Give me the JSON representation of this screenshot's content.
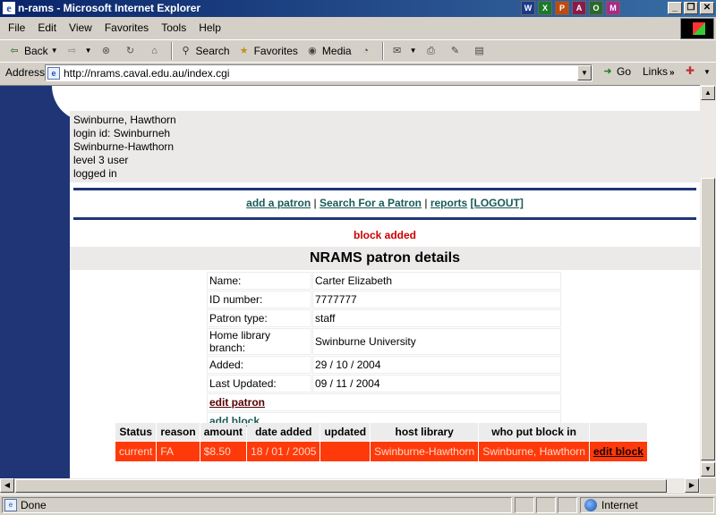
{
  "window": {
    "title": "n-rams - Microsoft Internet Explorer",
    "tray_icons": [
      "W",
      "X",
      "P",
      "A",
      "O",
      "M"
    ]
  },
  "menu": [
    "File",
    "Edit",
    "View",
    "Favorites",
    "Tools",
    "Help"
  ],
  "toolbar": {
    "back": "Back",
    "search": "Search",
    "favorites": "Favorites",
    "media": "Media"
  },
  "address": {
    "label": "Address",
    "url": "http://nrams.caval.edu.au/index.cgi",
    "go": "Go",
    "links": "Links"
  },
  "user": {
    "lines": [
      "Swinburne, Hawthorn",
      "login id: Swinburneh",
      "Swinburne-Hawthorn",
      "level 3 user",
      "logged in"
    ]
  },
  "nav": {
    "add_patron": "add a patron",
    "search_patron": "Search For a Patron",
    "reports": "reports",
    "logout": "[LOGOUT]",
    "sep": "|"
  },
  "message": "block added",
  "heading": "NRAMS patron details",
  "details": {
    "rows": [
      {
        "label": "Name:",
        "value": "Carter Elizabeth"
      },
      {
        "label": "ID number:",
        "value": "7777777"
      },
      {
        "label": "Patron type:",
        "value": "staff"
      },
      {
        "label": "Home library branch:",
        "value": "Swinburne University"
      },
      {
        "label": "Added:",
        "value": "29 / 10 / 2004"
      },
      {
        "label": "Last Updated:",
        "value": "09 / 11 / 2004"
      }
    ],
    "edit_patron": "edit patron",
    "add_block": "add block"
  },
  "blocks": {
    "headers": [
      "Status",
      "reason",
      "amount",
      "date added",
      "updated",
      "host library",
      "who put block in",
      ""
    ],
    "rows": [
      {
        "status": "current",
        "reason": "FA",
        "amount": "$8.50",
        "date_added": "18 / 01 / 2005",
        "updated": "",
        "host_library": "Swinburne-Hawthorn",
        "who": "Swinburne, Hawthorn",
        "action": "edit block"
      }
    ]
  },
  "status": {
    "text": "Done",
    "zone": "Internet"
  },
  "colors": {
    "titlebar": "#0a246a",
    "sidebar": "#1f3576",
    "block_row": "#ff3a0a",
    "message": "#cc0000"
  }
}
